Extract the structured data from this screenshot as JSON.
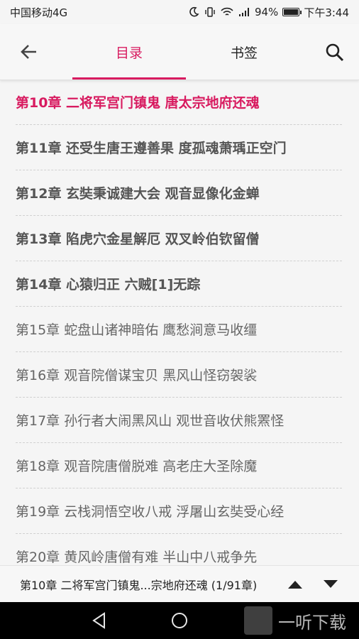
{
  "status": {
    "carrier": "中国移动4G",
    "battery": "94%",
    "time": "下午3:44"
  },
  "toolbar": {
    "tabs": [
      {
        "label": "目录"
      },
      {
        "label": "书签"
      }
    ]
  },
  "chapters": [
    {
      "label": "第10章 二将军宫门镇鬼 唐太宗地府还魂"
    },
    {
      "label": "第11章 还受生唐王遵善果 度孤魂萧瑀正空门"
    },
    {
      "label": "第12章 玄奘秉诚建大会 观音显像化金蝉"
    },
    {
      "label": "第13章 陷虎穴金星解厄 双叉岭伯钦留僧"
    },
    {
      "label": "第14章 心猿归正 六贼[1]无踪"
    },
    {
      "label": "第15章 蛇盘山诸神暗佑 鹰愁涧意马收缰"
    },
    {
      "label": "第16章 观音院僧谋宝贝 黑风山怪窃袈裟"
    },
    {
      "label": "第17章 孙行者大闹黑风山 观世音收伏熊罴怪"
    },
    {
      "label": "第18章 观音院唐僧脱难 高老庄大圣除魔"
    },
    {
      "label": "第19章 云栈洞悟空收八戒 浮屠山玄奘受心经"
    },
    {
      "label": "第20章 黄风岭唐僧有难 半山中八戒争先"
    }
  ],
  "bottom": {
    "current": "第10章 二将军宫门镇鬼...宗地府还魂 (1/91章)"
  },
  "watermark": "一听下载",
  "colors": {
    "accent": "#d81b60"
  }
}
